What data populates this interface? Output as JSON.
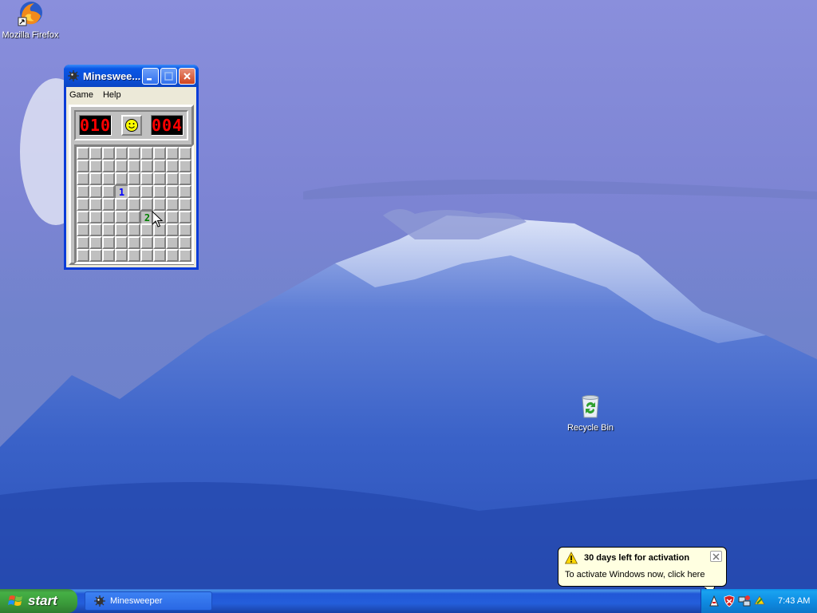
{
  "desktop": {
    "icons": [
      {
        "label": "Mozilla Firefox",
        "icon": "firefox-icon"
      },
      {
        "label": "Recycle Bin",
        "icon": "recycle-bin-icon"
      }
    ]
  },
  "minesweeper": {
    "title": "Mineswee...",
    "menu": [
      "Game",
      "Help"
    ],
    "mines_counter": "010",
    "timer": "004",
    "smiley": "smiley-face-icon",
    "grid": {
      "rows": 9,
      "cols": 9,
      "revealed": [
        {
          "row": 3,
          "col": 3,
          "value": "1"
        },
        {
          "row": 5,
          "col": 5,
          "value": "2"
        }
      ]
    }
  },
  "taskbar": {
    "start_label": "start",
    "tasks": [
      {
        "label": "Minesweeper",
        "icon": "minesweeper-icon"
      }
    ],
    "tray_icons": [
      "security-alert-icon",
      "shield-icon",
      "network-icon",
      "update-icon"
    ],
    "clock": "7:43 AM"
  },
  "balloon": {
    "title": "30 days left for activation",
    "body": "To activate Windows now, click here",
    "icon": "warning-icon"
  },
  "colors": {
    "taskbar_blue": "#245edb",
    "start_green": "#3a9a3a",
    "balloon_bg": "#ffffe1"
  }
}
